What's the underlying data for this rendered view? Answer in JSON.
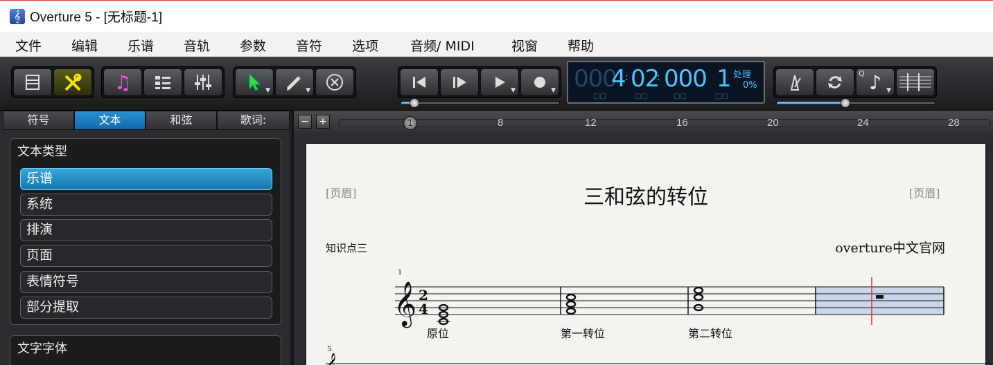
{
  "window": {
    "title": "Overture 5 - [无标题-1]",
    "icon": "treble-clef-icon"
  },
  "menu": [
    "文件",
    "编辑",
    "乐谱",
    "音轨",
    "参数",
    "音符",
    "选项",
    "音频/ MIDI",
    "视窗",
    "帮助"
  ],
  "counter": {
    "dim_digits": "000",
    "measure": "4",
    "beat": "02",
    "tick": "000",
    "track": "1",
    "status": "处理",
    "percent": "0%"
  },
  "left_panel": {
    "tabs": [
      "符号",
      "文本",
      "和弦",
      "歌词:"
    ],
    "active_tab": "文本",
    "text_type": {
      "title": "文本类型",
      "items": [
        "乐谱",
        "系统",
        "排演",
        "页面",
        "表情符号",
        "部分提取"
      ],
      "selected": "乐谱"
    },
    "font_section_title": "文字字体"
  },
  "ruler": {
    "marks": [
      "8",
      "12",
      "16",
      "20",
      "24",
      "28"
    ],
    "zoom_out": "−",
    "zoom_in": "+"
  },
  "score": {
    "header_left": "[页眉]",
    "header_right": "[页眉]",
    "title": "三和弦的转位",
    "subtitle_left": "知识点三",
    "subtitle_right": "overture中文官网",
    "measure_start_1": "1",
    "measure_start_2": "5",
    "time_signature": {
      "top": "2",
      "bottom": "4"
    },
    "chord_labels": [
      "原位",
      "第一转位",
      "第二转位"
    ]
  },
  "colors": {
    "accent": "#1a86c8",
    "counter_text": "#4fc3ff",
    "playhead": "#e03030",
    "selection": "#c9d6ea"
  }
}
